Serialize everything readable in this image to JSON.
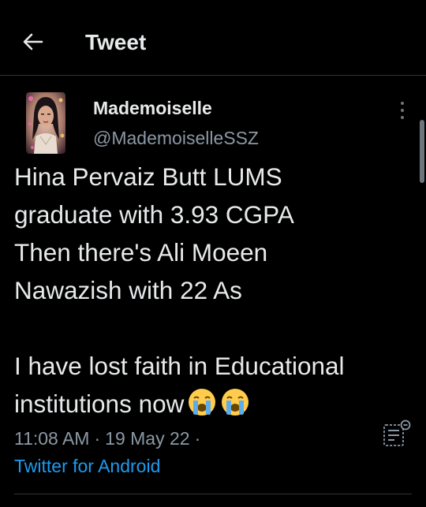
{
  "header": {
    "title": "Tweet",
    "back_icon": "arrow-left-icon"
  },
  "tweet": {
    "author": {
      "display_name": "Mademoiselle",
      "handle": "@MademoiselleSSZ",
      "avatar_icon": "avatar"
    },
    "text": "Hina Pervaiz Butt LUMS\ngraduate with 3.93 CGPA\nThen there's Ali Moeen\nNawazish with 22 As\n\nI have lost faith in Educational\ninstitutions now",
    "emojis": [
      "loudly-crying-face-icon",
      "loudly-crying-face-icon"
    ],
    "time": "11:08 AM",
    "date": "19 May 22",
    "separator": "·",
    "source": "Twitter for Android"
  },
  "colors": {
    "background": "#000000",
    "text_primary": "#e7e9ea",
    "text_secondary": "#8b98a5",
    "link": "#1d9bf0",
    "divider": "#2f3336"
  }
}
